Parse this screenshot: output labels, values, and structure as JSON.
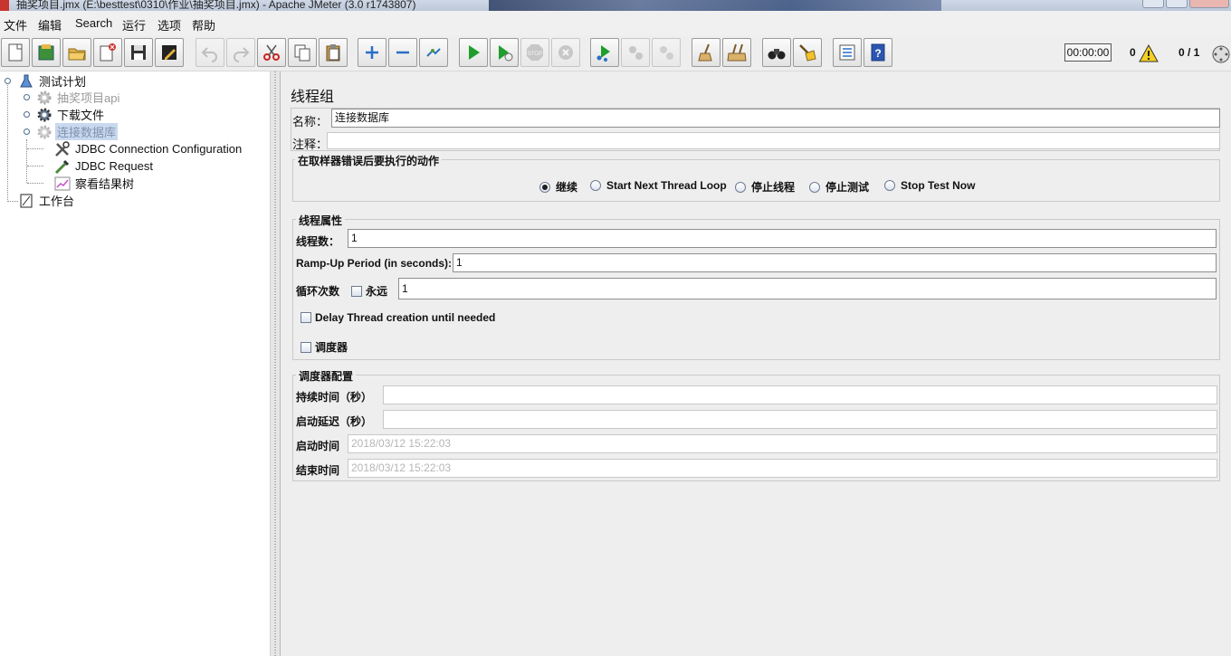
{
  "window": {
    "title": "抽奖项目.jmx (E:\\besttest\\0310\\作业\\抽奖项目.jmx) - Apache JMeter (3.0 r1743807)"
  },
  "menu": {
    "items": [
      "文件",
      "编辑",
      "Search",
      "运行",
      "选项",
      "帮助"
    ]
  },
  "toolbar": {
    "timer": "00:00:00",
    "error_count": "0",
    "threads": "0 / 1"
  },
  "tree": {
    "root": "测试计划",
    "children": [
      {
        "label": "抽奖项目api",
        "icon": "gear-icon",
        "state": "disabled"
      },
      {
        "label": "下载文件",
        "icon": "gear-icon",
        "state": "normal"
      },
      {
        "label": "连接数据库",
        "icon": "gear-icon",
        "state": "selected-disabled"
      }
    ],
    "sub_children": [
      {
        "label": "JDBC Connection Configuration",
        "icon": "wrench-icon"
      },
      {
        "label": "JDBC Request",
        "icon": "pipette-icon"
      },
      {
        "label": "察看结果树",
        "icon": "chart-icon"
      }
    ],
    "workbench": "工作台"
  },
  "thread_group": {
    "title": "线程组",
    "name_label": "名称：",
    "name_value": "连接数据库",
    "comment_label": "注释：",
    "comment_value": "",
    "on_error": {
      "title": "在取样器错误后要执行的动作",
      "options": [
        "继续",
        "Start Next Thread Loop",
        "停止线程",
        "停止测试",
        "Stop Test Now"
      ],
      "selected": "继续"
    },
    "props": {
      "title": "线程属性",
      "threads_label": "线程数：",
      "threads_value": "1",
      "rampup_label": "Ramp-Up Period (in seconds):",
      "rampup_value": "1",
      "loop_label": "循环次数",
      "forever_label": "永远",
      "loop_value": "1",
      "delay_label": "Delay Thread creation until needed",
      "scheduler_label": "调度器"
    },
    "scheduler": {
      "title": "调度器配置",
      "duration_label": "持续时间（秒）",
      "duration_value": "",
      "delay_label": "启动延迟（秒）",
      "delay_value": "",
      "start_label": "启动时间",
      "start_value": "2018/03/12 15:22:03",
      "end_label": "结束时间",
      "end_value": "2018/03/12 15:22:03"
    }
  }
}
